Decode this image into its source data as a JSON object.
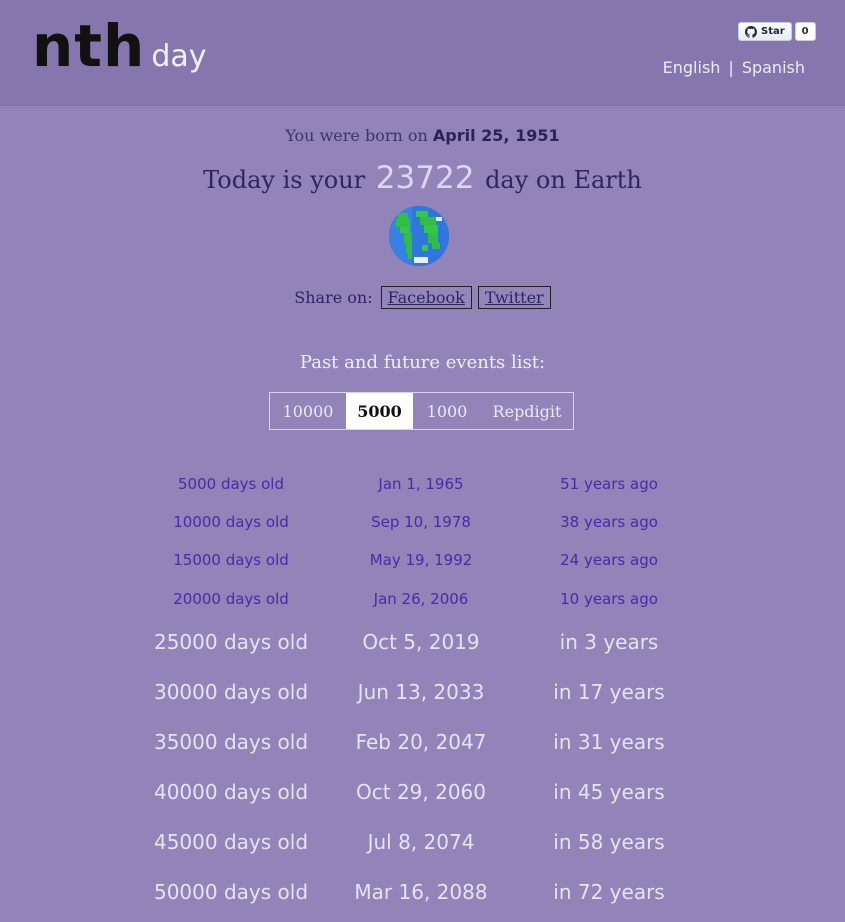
{
  "header": {
    "logo_main": "nth",
    "logo_sub": "day",
    "github": {
      "star_label": "Star",
      "count": "0"
    },
    "languages": [
      "English",
      "Spanish"
    ],
    "lang_separator": "|"
  },
  "born": {
    "prefix": "You were born on",
    "date": "April 25, 1951"
  },
  "today": {
    "prefix": "Today is your",
    "number": "23722",
    "suffix": "day on Earth"
  },
  "share": {
    "label": "Share on:",
    "facebook": "Facebook",
    "twitter": "Twitter"
  },
  "events": {
    "title": "Past and future events list:",
    "tabs": [
      "10000",
      "5000",
      "1000",
      "Repdigit"
    ],
    "active_tab": "5000",
    "rows": [
      {
        "age": "5000 days old",
        "date": "Jan 1, 1965",
        "when": "51 years ago",
        "past": true
      },
      {
        "age": "10000 days old",
        "date": "Sep 10, 1978",
        "when": "38 years ago",
        "past": true
      },
      {
        "age": "15000 days old",
        "date": "May 19, 1992",
        "when": "24 years ago",
        "past": true
      },
      {
        "age": "20000 days old",
        "date": "Jan 26, 2006",
        "when": "10 years ago",
        "past": true
      },
      {
        "age": "25000 days old",
        "date": "Oct 5, 2019",
        "when": "in 3 years",
        "past": false
      },
      {
        "age": "30000 days old",
        "date": "Jun 13, 2033",
        "when": "in 17 years",
        "past": false
      },
      {
        "age": "35000 days old",
        "date": "Feb 20, 2047",
        "when": "in 31 years",
        "past": false
      },
      {
        "age": "40000 days old",
        "date": "Oct 29, 2060",
        "when": "in 45 years",
        "past": false
      },
      {
        "age": "45000 days old",
        "date": "Jul 8, 2074",
        "when": "in 58 years",
        "past": false
      },
      {
        "age": "50000 days old",
        "date": "Mar 16, 2088",
        "when": "in 72 years",
        "past": false
      }
    ]
  },
  "colors": {
    "page_bg": "#9283b8",
    "header_bg": "#8576ad",
    "past_text": "#4a2aa8",
    "future_text": "#e8e2f7"
  },
  "icons": {
    "github": "github-icon",
    "globe": "earth-globe-icon"
  }
}
